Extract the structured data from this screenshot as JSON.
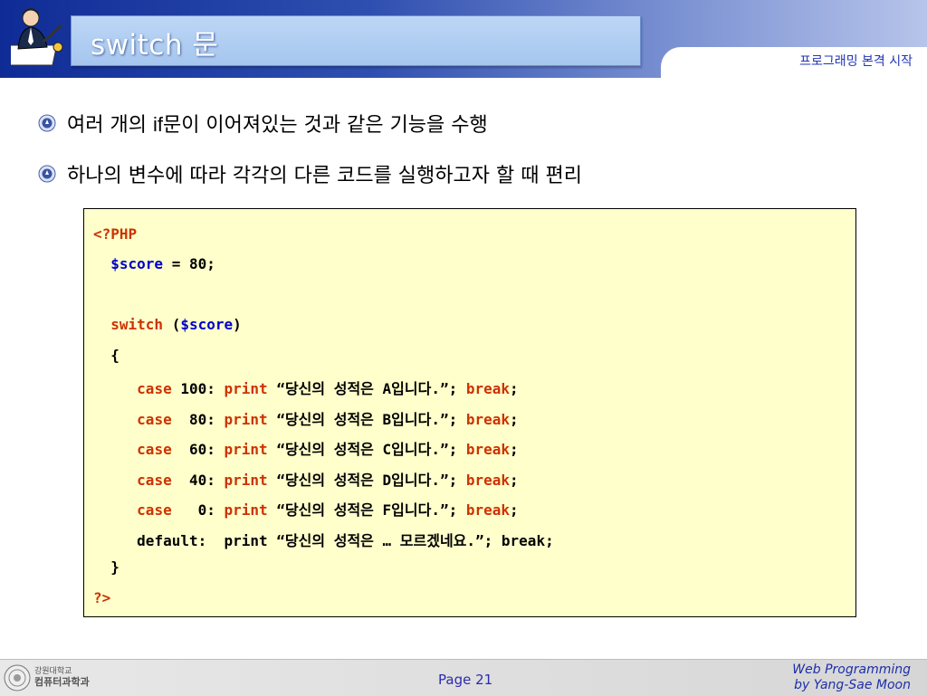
{
  "header": {
    "title": "switch 문",
    "section": "프로그래밍 본격 시작"
  },
  "bullets": [
    {
      "prefix": "여러 개의 ",
      "em": "if",
      "suffix": "문이 이어져있는 것과 같은 기능을 수행"
    },
    {
      "text": "하나의 변수에 따라 각각의 다른 코드를 실행하고자 할 때 편리"
    }
  ],
  "code": {
    "open_tag": "<?PHP",
    "assign_var": "$score",
    "assign_rest": " = 80;",
    "switch_kw": "switch",
    "switch_open": " (",
    "switch_var": "$score",
    "switch_close": ")",
    "brace_open": "{",
    "cases": [
      {
        "kw": "case",
        "value": " 100:",
        "fn": "print",
        "str": " “당신의 성적은 A입니다.”; ",
        "brk": "break",
        "end": ";"
      },
      {
        "kw": "case",
        "value": "  80:",
        "fn": "print",
        "str": " “당신의 성적은 B입니다.”; ",
        "brk": "break",
        "end": ";"
      },
      {
        "kw": "case",
        "value": "  60:",
        "fn": "print",
        "str": " “당신의 성적은 C입니다.”; ",
        "brk": "break",
        "end": ";"
      },
      {
        "kw": "case",
        "value": "  40:",
        "fn": "print",
        "str": " “당신의 성적은 D입니다.”; ",
        "brk": "break",
        "end": ";"
      },
      {
        "kw": "case",
        "value": "   0:",
        "fn": "print",
        "str": " “당신의 성적은 F입니다.”; ",
        "brk": "break",
        "end": ";"
      }
    ],
    "default_line": "default:  print “당신의 성적은 … 모르겠네요.”; break;",
    "brace_close": "}",
    "close_tag": "?>"
  },
  "footer": {
    "dept_line1": "강원대학교",
    "dept_line2": "컴퓨터과학과",
    "page": "Page 21",
    "credit_line1": "Web Programming",
    "credit_line2": "by Yang-Sae Moon"
  },
  "colors": {
    "keyword": "#cc3300",
    "variable": "#0000cc",
    "code_bg": "#ffffcc",
    "header_dark": "#0f2c96"
  }
}
